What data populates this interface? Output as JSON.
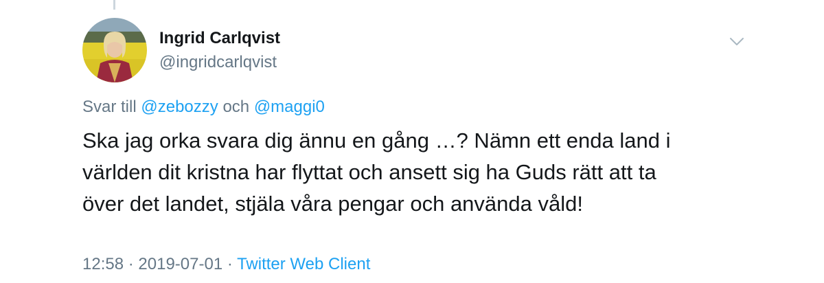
{
  "tweet": {
    "author": {
      "name": "Ingrid Carlqvist",
      "handle": "@ingridcarlqvist"
    },
    "reply": {
      "prefix": "Svar till",
      "mention1": "@zebozzy",
      "conjunction": "och",
      "mention2": "@maggi0"
    },
    "text_lines": [
      "Ska jag orka svara dig ännu en gång …? Nämn ett enda land i",
      "världen dit kristna har flyttat och ansett sig ha Guds rätt att ta",
      "över det landet, stjäla våra pengar och använda våld!"
    ],
    "meta": {
      "time": "12:58",
      "sep1": "·",
      "date": "2019-07-01",
      "sep2": "·",
      "source": "Twitter Web Client"
    },
    "icons": {
      "menu": "chevron-down-icon",
      "avatar": "avatar"
    },
    "colors": {
      "link": "#1da1f2",
      "secondary_text": "#657786",
      "primary_text": "#14171a"
    }
  }
}
